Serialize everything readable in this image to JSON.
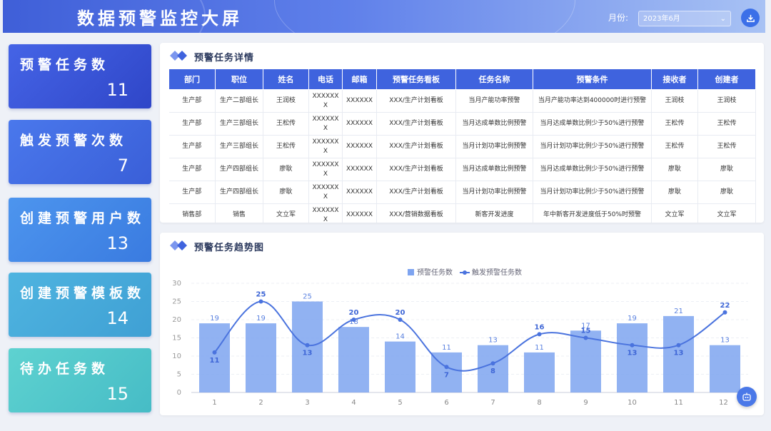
{
  "header": {
    "title": "数据预警监控大屏",
    "month_label": "月份:",
    "month_value": "2023年6月"
  },
  "stats": [
    {
      "label": "预警任务数",
      "value": "11"
    },
    {
      "label": "触发预警次数",
      "value": "7"
    },
    {
      "label": "创建预警用户数",
      "value": "13"
    },
    {
      "label": "创建预警模板数",
      "value": "14"
    },
    {
      "label": "待办任务数",
      "value": "15"
    }
  ],
  "detail": {
    "title": "预警任务详情",
    "columns": [
      "部门",
      "职位",
      "姓名",
      "电话",
      "邮箱",
      "预警任务看板",
      "任务名称",
      "预警条件",
      "接收者",
      "创建者"
    ],
    "rows": [
      [
        "生产部",
        "生产二部组长",
        "王润枝",
        "XXXXXX X",
        "XXXXXX",
        "XXX/生产计划看板",
        "当月产能功率预警",
        "当月产能功率达到400000时进行预警",
        "王润枝",
        "王润枝"
      ],
      [
        "生产部",
        "生产三部组长",
        "王松传",
        "XXXXXX X",
        "XXXXXX",
        "XXX/生产计划看板",
        "当月达成单数比例预警",
        "当月达成单数比例少于50%进行预警",
        "王松传",
        "王松传"
      ],
      [
        "生产部",
        "生产三部组长",
        "王松传",
        "XXXXXX X",
        "XXXXXX",
        "XXX/生产计划看板",
        "当月计划功率比例预警",
        "当月计划功率比例少于50%进行预警",
        "王松传",
        "王松传"
      ],
      [
        "生产部",
        "生产四部组长",
        "廖耿",
        "XXXXXX X",
        "XXXXXX",
        "XXX/生产计划看板",
        "当月达成单数比例预警",
        "当月达成单数比例少于50%进行预警",
        "廖耿",
        "廖耿"
      ],
      [
        "生产部",
        "生产四部组长",
        "廖耿",
        "XXXXXX X",
        "XXXXXX",
        "XXX/生产计划看板",
        "当月计划功率比例预警",
        "当月计划功率比例少于50%进行预警",
        "廖耿",
        "廖耿"
      ],
      [
        "销售部",
        "销售",
        "文立军",
        "XXXXXX X",
        "XXXXXX",
        "XXX/营销数据看板",
        "新客开发进度",
        "年中新客开发进度低于50%时预警",
        "文立军",
        "文立军"
      ]
    ]
  },
  "trend": {
    "title": "预警任务趋势图"
  },
  "chart_data": {
    "type": "bar",
    "categories": [
      "1",
      "2",
      "3",
      "4",
      "5",
      "6",
      "7",
      "8",
      "9",
      "10",
      "11",
      "12"
    ],
    "series": [
      {
        "name": "预警任务数",
        "type": "bar",
        "values": [
          19,
          19,
          25,
          18,
          14,
          11,
          13,
          11,
          17,
          19,
          21,
          13
        ],
        "labels": [
          "19",
          "19",
          "25",
          "18",
          "14",
          "11",
          "13",
          "11",
          "17",
          "19",
          "21",
          "13"
        ]
      },
      {
        "name": "触发预警任务数",
        "type": "line",
        "values": [
          11,
          25,
          13,
          20,
          20,
          7,
          8,
          16,
          15,
          13,
          13,
          22
        ],
        "labels": [
          "11",
          "25",
          "13",
          "20",
          "20",
          "7",
          "8",
          "16",
          "15",
          "13",
          "13",
          "22"
        ]
      }
    ],
    "yticks": [
      "0",
      "5",
      "10",
      "15",
      "20",
      "25",
      "30"
    ],
    "ylim": [
      0,
      30
    ],
    "legend": "top-center",
    "colors": {
      "bar": "#7ea4f0",
      "line": "#4a73de"
    }
  }
}
